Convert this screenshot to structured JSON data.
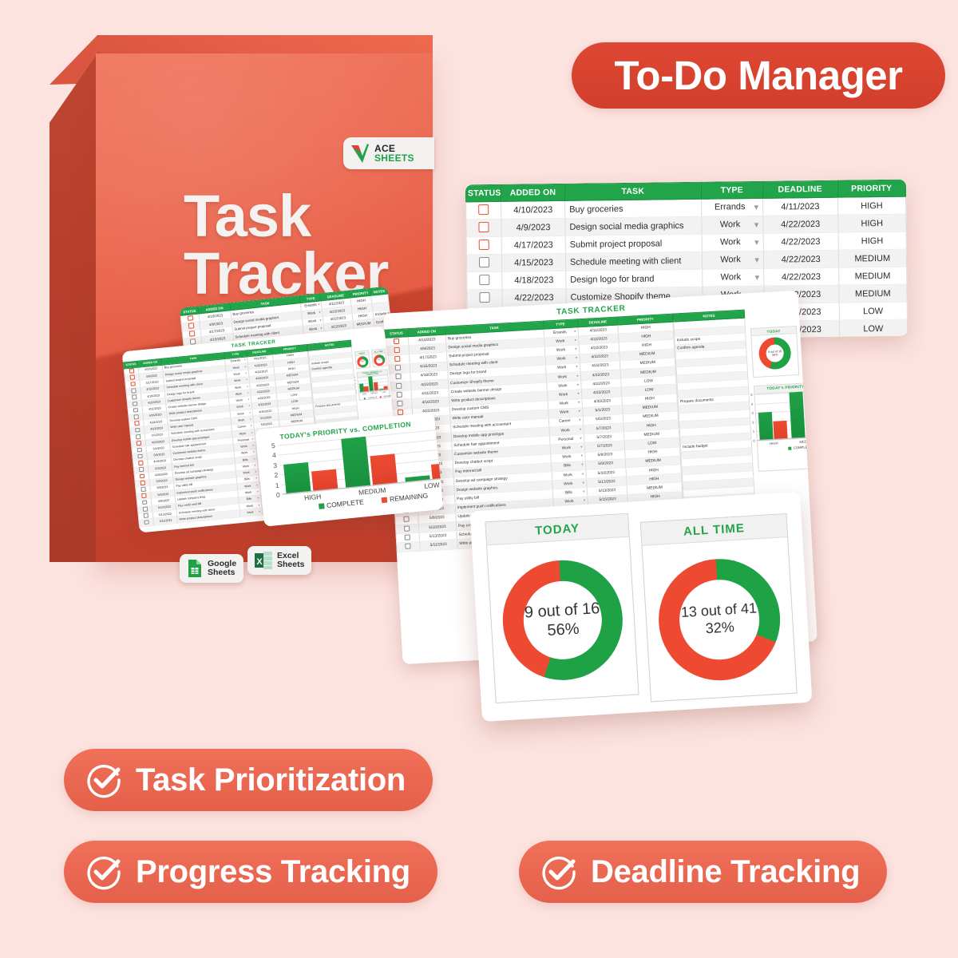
{
  "background_color": "#FCE3E0",
  "brand": {
    "accent_red": "#DE4733",
    "accent_green": "#22A44A",
    "box_title": "Task Tracker",
    "logo_line1": "ACE",
    "logo_line2": "SHEETS",
    "logo_icon": "ace-check-leaf-mark"
  },
  "header_badge": {
    "label": "To-Do Manager"
  },
  "feature_pills": [
    {
      "label": "Task Prioritization",
      "icon": "check-circle-icon"
    },
    {
      "label": "Progress Tracking",
      "icon": "check-circle-icon"
    },
    {
      "label": "Deadline Tracking",
      "icon": "check-circle-icon"
    }
  ],
  "platform_badges": [
    {
      "line1": "Google",
      "line2": "Sheets",
      "icon": "google-sheets-icon"
    },
    {
      "line1": "Excel",
      "line2": "Sheets",
      "icon": "microsoft-excel-icon"
    }
  ],
  "spreadsheet": {
    "title": "TASK TRACKER",
    "columns": [
      "STATUS",
      "ADDED ON",
      "TASK",
      "TYPE",
      "DEADLINE",
      "PRIORITY",
      "NOTES"
    ],
    "rows": [
      {
        "status": false,
        "added_on": "4/10/2023",
        "task": "Buy groceries",
        "type": "Errands",
        "deadline": "4/11/2023",
        "priority": "HIGH",
        "notes": "",
        "overdue": true
      },
      {
        "status": false,
        "added_on": "4/9/2023",
        "task": "Design social media graphics",
        "type": "Work",
        "deadline": "4/22/2023",
        "priority": "HIGH",
        "notes": "",
        "overdue": true
      },
      {
        "status": false,
        "added_on": "4/17/2023",
        "task": "Submit project proposal",
        "type": "Work",
        "deadline": "4/22/2023",
        "priority": "HIGH",
        "notes": "Include scope",
        "overdue": true
      },
      {
        "status": false,
        "added_on": "4/15/2023",
        "task": "Schedule meeting with client",
        "type": "Work",
        "deadline": "4/22/2023",
        "priority": "MEDIUM",
        "notes": "Confirm agenda",
        "overdue": false
      },
      {
        "status": false,
        "added_on": "4/18/2023",
        "task": "Design logo for brand",
        "type": "Work",
        "deadline": "4/22/2023",
        "priority": "MEDIUM",
        "notes": "",
        "overdue": false
      },
      {
        "status": false,
        "added_on": "4/22/2023",
        "task": "Customize Shopify theme",
        "type": "Work",
        "deadline": "4/22/2023",
        "priority": "MEDIUM",
        "notes": "",
        "overdue": false
      },
      {
        "status": false,
        "added_on": "4/11/2023",
        "task": "Create website banner design",
        "type": "Work",
        "deadline": "4/22/2023",
        "priority": "LOW",
        "notes": "",
        "overdue": false
      },
      {
        "status": false,
        "added_on": "4/16/2023",
        "task": "Write product descriptions",
        "type": "Work",
        "deadline": "4/22/2023",
        "priority": "LOW",
        "notes": "",
        "overdue": false
      },
      {
        "status": false,
        "added_on": "4/22/2023",
        "task": "Develop custom CMS",
        "type": "Work",
        "deadline": "4/30/2023",
        "priority": "HIGH",
        "notes": "",
        "overdue": true
      },
      {
        "status": false,
        "added_on": "4/22/2023",
        "task": "Write user manual",
        "type": "Work",
        "deadline": "5/1/2023",
        "priority": "MEDIUM",
        "notes": "",
        "overdue": false
      },
      {
        "status": false,
        "added_on": "5/1/2023",
        "task": "Schedule meeting with accountant",
        "type": "Career",
        "deadline": "5/5/2023",
        "priority": "MEDIUM",
        "notes": "Prepare documents",
        "overdue": false
      },
      {
        "status": false,
        "added_on": "4/23/2023",
        "task": "Develop mobile app prototype",
        "type": "Work",
        "deadline": "5/7/2023",
        "priority": "HIGH",
        "notes": "",
        "overdue": true
      },
      {
        "status": false,
        "added_on": "5/4/2023",
        "task": "Schedule hair appointment",
        "type": "Personal",
        "deadline": "5/7/2023",
        "priority": "MEDIUM",
        "notes": "",
        "overdue": false
      },
      {
        "status": false,
        "added_on": "5/3/2023",
        "task": "Customize website theme",
        "type": "Work",
        "deadline": "5/7/2023",
        "priority": "LOW",
        "notes": "",
        "overdue": false
      },
      {
        "status": false,
        "added_on": "4/19/2023",
        "task": "Develop chatbot script",
        "type": "Work",
        "deadline": "5/9/2023",
        "priority": "HIGH",
        "notes": "",
        "overdue": true
      },
      {
        "status": false,
        "added_on": "5/2/2023",
        "task": "Pay internet bill",
        "type": "Bills",
        "deadline": "5/9/2023",
        "priority": "MEDIUM",
        "notes": "",
        "overdue": false
      },
      {
        "status": false,
        "added_on": "4/30/2023",
        "task": "Develop ad campaign strategy",
        "type": "Work",
        "deadline": "5/10/2023",
        "priority": "HIGH",
        "notes": "Include budget",
        "overdue": true
      },
      {
        "status": false,
        "added_on": "5/9/2023",
        "task": "Design website graphics",
        "type": "Work",
        "deadline": "5/13/2023",
        "priority": "HIGH",
        "notes": "",
        "overdue": true
      },
      {
        "status": false,
        "added_on": "5/8/2023",
        "task": "Pay utility bill",
        "type": "Bills",
        "deadline": "5/13/2023",
        "priority": "MEDIUM",
        "notes": "",
        "overdue": false
      },
      {
        "status": false,
        "added_on": "5/5/2023",
        "task": "Implement push notifications",
        "type": "Work",
        "deadline": "5/15/2023",
        "priority": "HIGH",
        "notes": "",
        "overdue": true
      },
      {
        "status": false,
        "added_on": "5/8/2023",
        "task": "Update company blog",
        "type": "Work",
        "deadline": "5/15/2023",
        "priority": "MEDIUM",
        "notes": "",
        "overdue": false
      },
      {
        "status": false,
        "added_on": "5/10/2023",
        "task": "Pay credit card bill",
        "type": "Bills",
        "deadline": "5/16/2023",
        "priority": "LOW",
        "notes": "",
        "overdue": false
      },
      {
        "status": false,
        "added_on": "5/13/2023",
        "task": "Schedule meeting with client",
        "type": "Work",
        "deadline": "5/18/2023",
        "priority": "MEDIUM",
        "notes": "",
        "overdue": false
      },
      {
        "status": false,
        "added_on": "5/11/2023",
        "task": "Write product descriptions",
        "type": "Work",
        "deadline": "5/20/2023",
        "priority": "LOW",
        "notes": "",
        "overdue": false
      }
    ]
  },
  "chart_data": [
    {
      "type": "pie",
      "id": "today-donut",
      "title": "TODAY",
      "labels": [
        "Complete",
        "Remaining"
      ],
      "values": [
        9,
        7
      ],
      "colors": [
        "#1FA146",
        "#EE4A32"
      ],
      "center_line1": "9 out of 16",
      "center_line2": "56%",
      "percent_complete": 56,
      "total": 16
    },
    {
      "type": "pie",
      "id": "alltime-donut",
      "title": "ALL TIME",
      "labels": [
        "Complete",
        "Remaining"
      ],
      "values": [
        13,
        28
      ],
      "colors": [
        "#1FA146",
        "#EE4A32"
      ],
      "center_line1": "13 out of 41",
      "center_line2": "32%",
      "percent_complete": 32,
      "total": 41
    },
    {
      "type": "bar",
      "id": "priority-vs-completion",
      "title": "TODAY's PRIORITY vs. COMPLETION",
      "categories": [
        "HIGH",
        "MEDIUM",
        "LOW"
      ],
      "series": [
        {
          "name": "COMPLETE",
          "values": [
            3,
            5,
            0.5
          ],
          "color": "#1FA146"
        },
        {
          "name": "REMAINING",
          "values": [
            2,
            3,
            1.5
          ],
          "color": "#EE4A32"
        }
      ],
      "ylim": [
        0,
        5
      ],
      "yticks": [
        0,
        1,
        2,
        3,
        4,
        5
      ],
      "xlabel": "",
      "ylabel": "",
      "grid": true,
      "legend_position": "bottom"
    }
  ]
}
